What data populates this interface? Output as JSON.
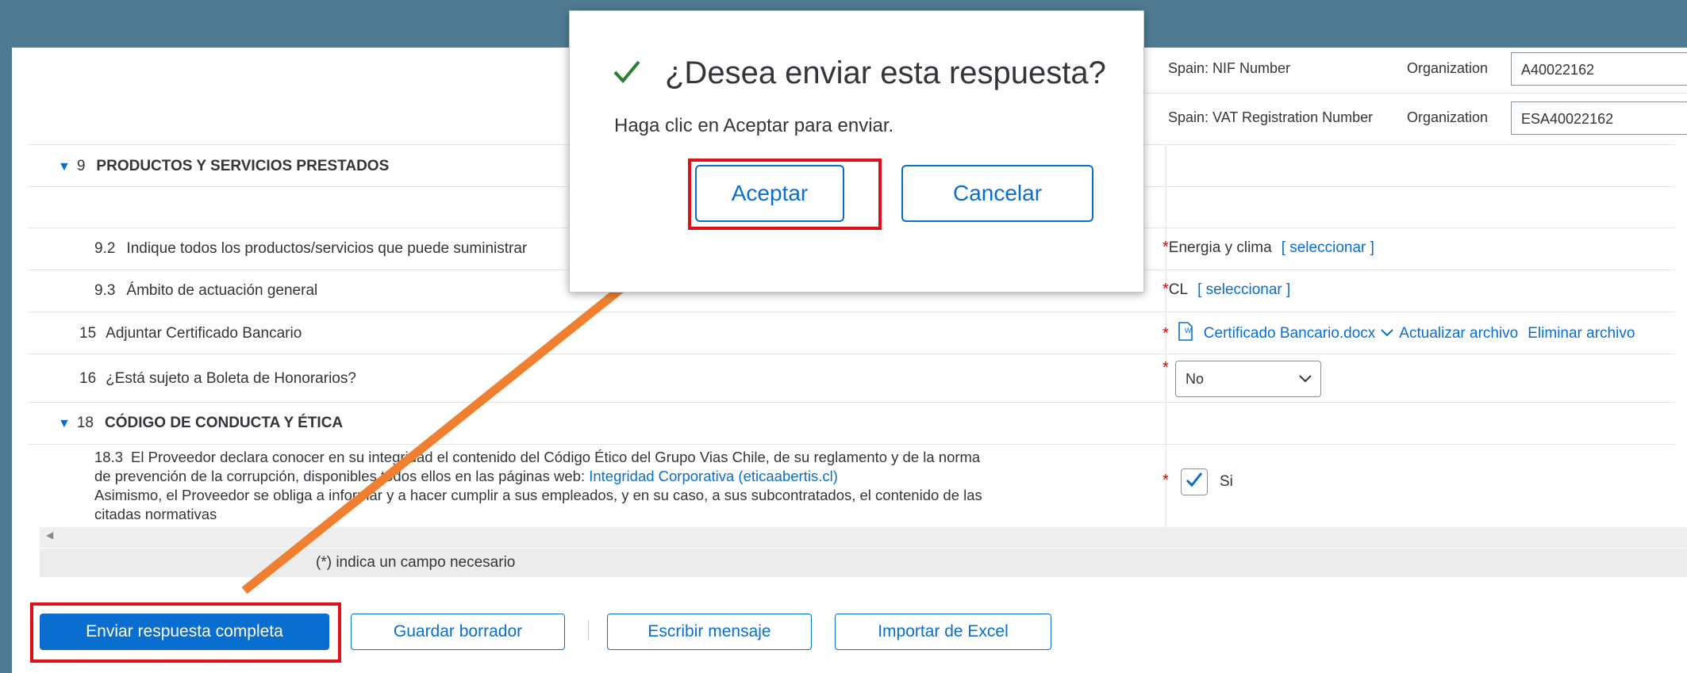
{
  "org_fields": [
    {
      "label": "Spain: NIF Number",
      "type": "Organization",
      "value": "A40022162"
    },
    {
      "label": "Spain: VAT Registration Number",
      "type": "Organization",
      "value": "ESA40022162"
    }
  ],
  "section9": {
    "num": "9",
    "title": "PRODUCTOS Y SERVICIOS PRESTADOS"
  },
  "q92": {
    "num": "9.2",
    "text": "Indique todos los productos/servicios que puede suministrar",
    "value": "Energia y clima",
    "select_link": "[ seleccionar ]"
  },
  "q93": {
    "num": "9.3",
    "text": "Ámbito de actuación general",
    "value": "CL",
    "select_link": "[ seleccionar ]"
  },
  "q15": {
    "num": "15",
    "text": "Adjuntar Certificado Bancario",
    "file": "Certificado Bancario.docx",
    "update": "Actualizar archivo",
    "delete": "Eliminar archivo"
  },
  "q16": {
    "num": "16",
    "text": "¿Está sujeto a Boleta de Honorarios?",
    "value": "No"
  },
  "section18": {
    "num": "18",
    "title": "CÓDIGO DE CONDUCTA Y ÉTICA"
  },
  "q183": {
    "num": "18.3",
    "line1": "El Proveedor declara conocer en su integridad el contenido del Código Ético del Grupo Vias Chile, de su reglamento y de la norma",
    "line2": "de prevención de la corrupción, disponibles todos ellos en las páginas web:",
    "link": "Integridad Corporativa (eticaabertis.cl)",
    "line3": "Asimismo, el Proveedor se obliga a informar y a hacer cumplir a sus empleados, y en su caso, a sus subcontratados, el contenido de las",
    "line4": "citadas normativas",
    "value": "Si"
  },
  "required_hint": "(*) indica un campo necesario",
  "buttons": {
    "submit": "Enviar respuesta completa",
    "save_draft": "Guardar borrador",
    "message": "Escribir mensaje",
    "import_excel": "Importar de Excel"
  },
  "dialog": {
    "title": "¿Desea enviar esta respuesta?",
    "body": "Haga clic en Aceptar para enviar.",
    "ok": "Aceptar",
    "cancel": "Cancelar"
  },
  "colors": {
    "accent": "#0a6ed1",
    "highlight": "#e0101a",
    "arrow": "#f08030"
  }
}
